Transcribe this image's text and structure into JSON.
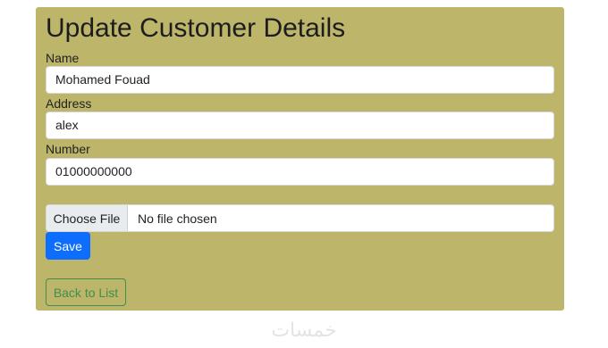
{
  "form": {
    "title": "Update Customer Details",
    "name_label": "Name",
    "name_value": "Mohamed Fouad",
    "address_label": "Address",
    "address_value": "alex",
    "number_label": "Number",
    "number_value": "01000000000",
    "file_button_label": "Choose File",
    "file_status": "No file chosen",
    "save_label": "Save",
    "back_label": "Back to List"
  },
  "watermark": {
    "text": "خمسات"
  },
  "colors": {
    "card_background": "#bcb56a",
    "primary": "#0d6efd",
    "success_outline": "#3f8f4e"
  }
}
